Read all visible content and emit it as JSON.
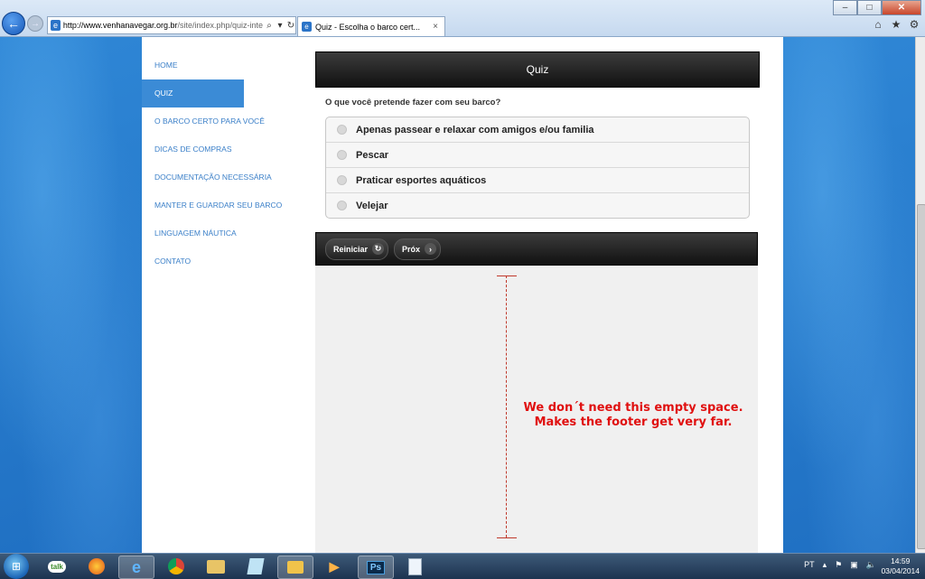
{
  "browser": {
    "url_host": "http://www.venhanavegar.org.br",
    "url_rest": "/site/index.php/quiz-inte",
    "tab_title": "Quiz - Escolha o barco cert...",
    "tab_close": "×",
    "min": "–",
    "max": "□",
    "close": "✕"
  },
  "sidebar": {
    "items": [
      {
        "label": "HOME"
      },
      {
        "label": "QUIZ"
      },
      {
        "label": "O BARCO CERTO PARA VOCÊ"
      },
      {
        "label": "DICAS DE COMPRAS"
      },
      {
        "label": "DOCUMENTAÇÃO NECESSÁRIA"
      },
      {
        "label": "MANTER E GUARDAR SEU BARCO"
      },
      {
        "label": "LINGUAGEM NÁUTICA"
      },
      {
        "label": "CONTATO"
      }
    ]
  },
  "quiz": {
    "header": "Quiz",
    "question": "O que você pretende fazer com seu barco?",
    "options": [
      "Apenas passear e relaxar com amigos e/ou familia",
      "Pescar",
      "Praticar esportes aquáticos",
      "Velejar"
    ],
    "restart_label": "Reiniciar",
    "next_label": "Próx"
  },
  "annotation": {
    "line1": "We don´t need this empty space.",
    "line2": "Makes the footer get very far."
  },
  "taskbar": {
    "apps": [
      "talk",
      "firefox",
      "ie",
      "chrome",
      "explorer",
      "notepad",
      "outlook",
      "media",
      "Ps",
      "doc"
    ],
    "language": "PT",
    "time": "14:59",
    "date": "03/04/2014"
  }
}
